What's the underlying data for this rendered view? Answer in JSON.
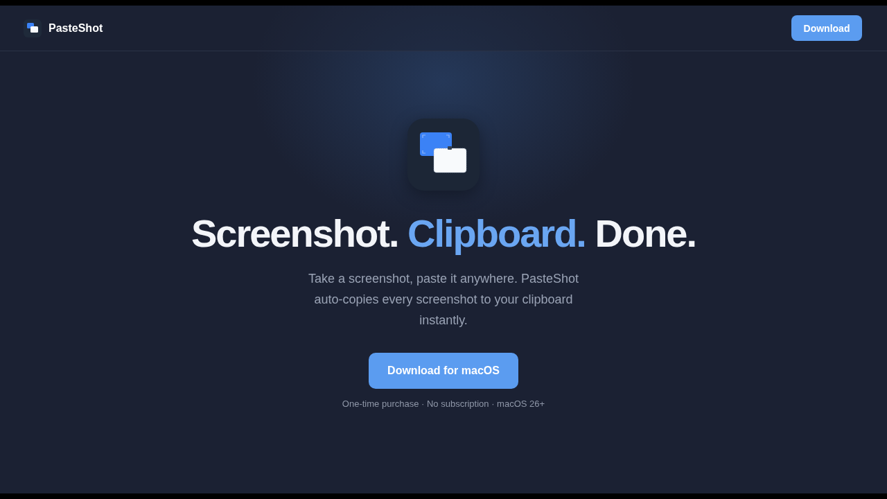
{
  "nav": {
    "brand": "PasteShot",
    "button": "Download"
  },
  "hero": {
    "headline": [
      {
        "text": "Screenshot.",
        "accent": false
      },
      {
        "text": "Clipboard.",
        "accent": true
      },
      {
        "text": "Done.",
        "accent": false
      }
    ],
    "subtitle": "Take a screenshot, paste it anywhere. PasteShot auto-copies every screenshot to your clipboard instantly.",
    "cta": "Download for macOS",
    "note": "One-time purchase · No subscription · macOS 26+"
  }
}
